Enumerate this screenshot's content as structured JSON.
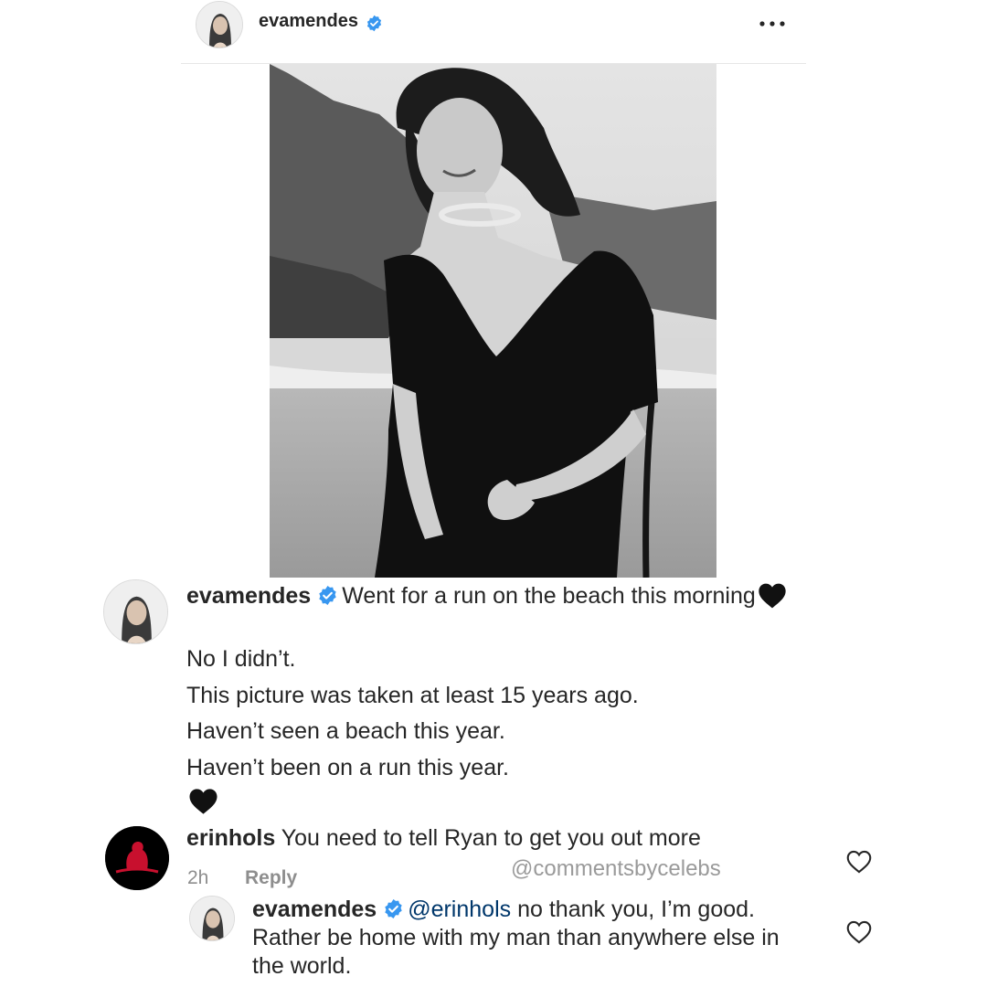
{
  "header": {
    "username": "evamendes",
    "verified": true
  },
  "post": {
    "photo": "black-and-white beach portrait",
    "caption_username": "evamendes",
    "caption_text": "Went for a run on the beach this morning",
    "caption_emoji": "black-heart",
    "lines": [
      "No I didn’t.",
      "This picture was taken at least 15 years ago.",
      "Haven’t seen a beach this year.",
      "Haven’t been on a run this year."
    ],
    "closing_emoji": "black-heart"
  },
  "comment": {
    "username": "erinhols",
    "text": "You need to tell Ryan to get you out more",
    "time": "2h",
    "reply_label": "Reply"
  },
  "watermark": "@commentsbycelebs",
  "reply": {
    "username": "evamendes",
    "mention": "@erinhols",
    "text": " no thank you, I’m good. Rather be home with my man than anywhere else in the world."
  },
  "colors": {
    "verified_blue": "#3897f0",
    "meta_gray": "#8e8e8e",
    "mention_blue": "#00376b",
    "text": "#262626"
  }
}
